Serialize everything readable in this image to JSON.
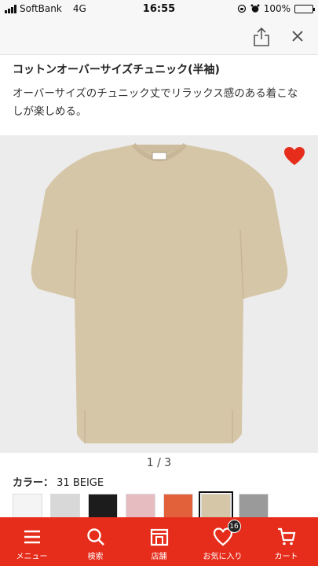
{
  "status_bar": {
    "carrier": "SoftBank",
    "network": "4G",
    "time": "16:55",
    "battery": "100%"
  },
  "product": {
    "title": "コットンオーバーサイズチュニック(半袖)",
    "description": "オーバーサイズのチュニック丈でリラックス感のある着こなしが楽しめる。",
    "image_counter": "1 / 3",
    "color_label": "カラー：",
    "color_value": "31 BEIGE",
    "favorite_color": "#e62d1c",
    "shirt_color": "#d6c6a8"
  },
  "swatches": [
    {
      "color": "#f4f4f4"
    },
    {
      "color": "#d8d8d8"
    },
    {
      "color": "#1c1c1c"
    },
    {
      "color": "#e6bcc1"
    },
    {
      "color": "#e2603a"
    },
    {
      "color": "#d6c6a8",
      "selected": true
    },
    {
      "color": "#9a9a9a"
    }
  ],
  "tab_bar": {
    "background": "#e62d1c",
    "items": [
      {
        "label": "メニュー",
        "icon": "menu-icon"
      },
      {
        "label": "検索",
        "icon": "search-icon"
      },
      {
        "label": "店舗",
        "icon": "store-icon"
      },
      {
        "label": "お気に入り",
        "icon": "heart-icon",
        "badge": "16"
      },
      {
        "label": "カート",
        "icon": "cart-icon"
      }
    ]
  }
}
